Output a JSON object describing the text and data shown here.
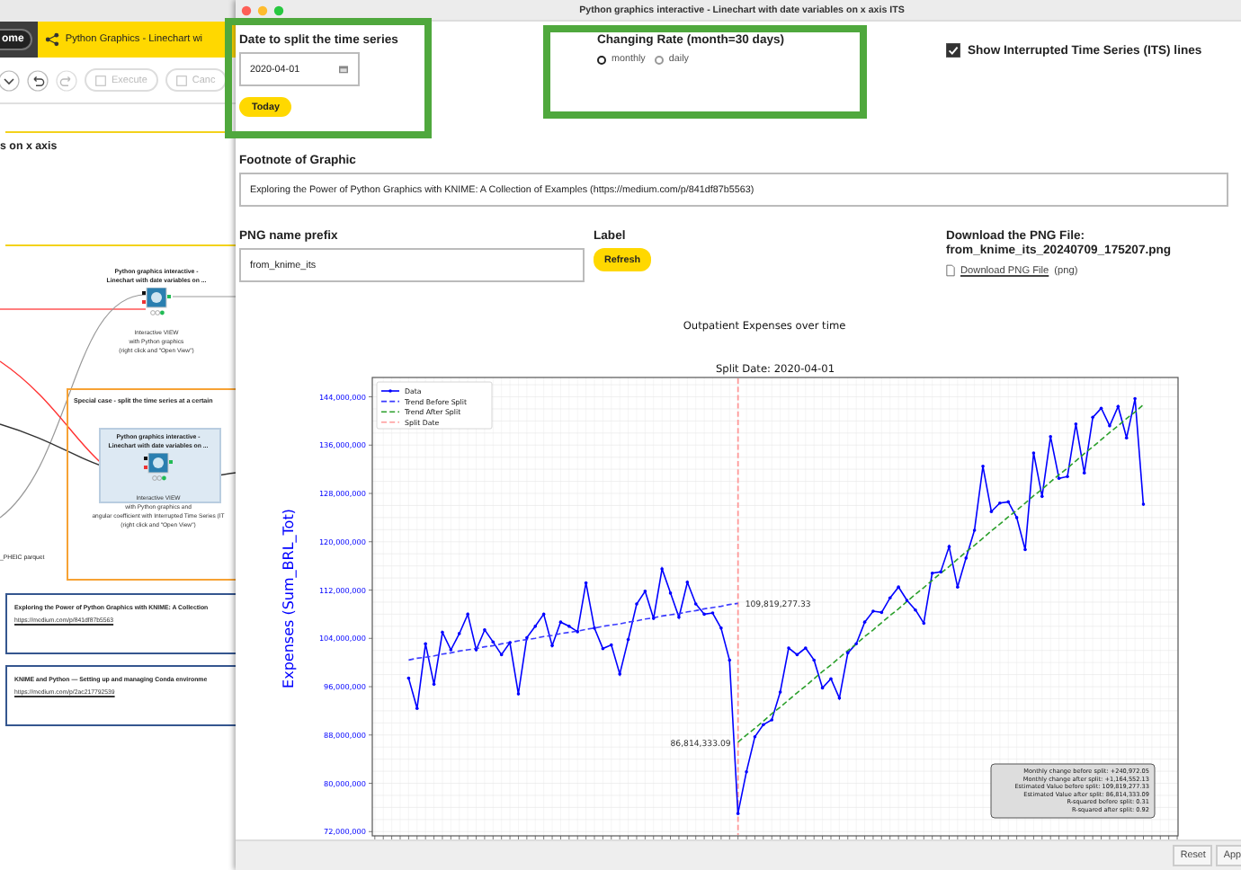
{
  "background_app": {
    "home_button": "ome",
    "tab": {
      "label": "Python Graphics - Linechart wi"
    },
    "toolbar": [
      {
        "label": "Execute",
        "disabled": true
      },
      {
        "label": "Canc",
        "disabled": true
      }
    ],
    "canvas": {
      "section_title": "s on x axis",
      "nodes": [
        {
          "title": [
            "Python graphics interactive -",
            "Linechart with date variables on ..."
          ],
          "caption": [
            "Interactive VIEW",
            "with Python graphics",
            "(right click and \"Open View\")"
          ],
          "selected": false
        },
        {
          "title": [
            "Python graphics interactive -",
            "Linechart with date variables on ..."
          ],
          "caption": [
            "Interactive VIEW",
            "with Python graphics and",
            "angular coefficient with Interrupted Time Series (IT",
            "(right click and \"Open View\")"
          ],
          "selected": true
        }
      ],
      "section": {
        "title": "Special case - split the time series at a certain"
      },
      "file_label": "_PHEIC parquet",
      "notes": [
        {
          "title": "Exploring the Power of Python Graphics with KNIME: A Collection",
          "link": "https://medium.com/p/841df87b5563"
        },
        {
          "title": "KNIME and Python — Setting up and managing Conda environme",
          "link": "https://medium.com/p/2ac217792539"
        }
      ]
    }
  },
  "dialog": {
    "title": "Python graphics interactive - Linechart with date variables on x axis ITS",
    "split_date": {
      "label": "Date to split the time series",
      "value": "2020-04-01",
      "button": "Today"
    },
    "changing_rate": {
      "label": "Changing Rate (month=30 days)",
      "options": [
        {
          "label": "monthly",
          "selected": true
        },
        {
          "label": "daily",
          "selected": false
        }
      ]
    },
    "its_lines": {
      "label": "Show Interrupted Time Series (ITS) lines",
      "checked": true
    },
    "footnote": {
      "label": "Footnote of Graphic",
      "value": "Exploring the Power of Python Graphics with KNIME: A Collection of Examples (https://medium.com/p/841df87b5563)"
    },
    "png_prefix": {
      "label": "PNG name prefix",
      "value": "from_knime_its"
    },
    "refresh": {
      "label": "Label",
      "button": "Refresh"
    },
    "download": {
      "title": "Download the PNG File:",
      "filename": "from_knime_its_20240709_175207.png",
      "link": "Download PNG File",
      "suffix": "(png)"
    },
    "chart": {
      "heading": "Outpatient Expenses over time",
      "chart_data": {
        "type": "line",
        "title": "Split Date: 2020-04-01",
        "ylabel": "Expenses (Sum_BRL_Tot)",
        "ylim": [
          71300000,
          147200000
        ],
        "grid": true,
        "legend": "upper left",
        "yticks": [
          {
            "value": 72000000,
            "label": "72,000,000"
          },
          {
            "value": 80000000,
            "label": "80,000,000"
          },
          {
            "value": 88000000,
            "label": "88,000,000"
          },
          {
            "value": 96000000,
            "label": "96,000,000"
          },
          {
            "value": 104000000,
            "label": "104,000,000"
          },
          {
            "value": 112000000,
            "label": "112,000,000"
          },
          {
            "value": 120000000,
            "label": "120,000,000"
          },
          {
            "value": 128000000,
            "label": "128,000,000"
          },
          {
            "value": 136000000,
            "label": "136,000,000"
          },
          {
            "value": 144000000,
            "label": "144,000,000"
          }
        ],
        "series": [
          {
            "name": "Data",
            "line_style": "solid",
            "color": "#0000ff",
            "values": [
              97400000,
              92400000,
              103100000,
              96400000,
              105000000,
              102100000,
              104800000,
              108000000,
              102100000,
              105400000,
              103400000,
              101300000,
              103300000,
              94800000,
              104100000,
              106000000,
              108000000,
              102800000,
              106700000,
              106000000,
              105100000,
              113200000,
              105700000,
              102300000,
              102900000,
              98100000,
              103800000,
              109700000,
              111800000,
              107300000,
              115500000,
              111500000,
              107500000,
              113300000,
              109700000,
              108000000,
              108200000,
              105700000,
              100400000,
              75000000,
              81900000,
              87700000,
              89700000,
              90500000,
              95100000,
              102400000,
              101300000,
              102400000,
              100400000,
              95800000,
              97300000,
              94100000,
              101600000,
              103100000,
              106700000,
              108500000,
              108300000,
              110700000,
              112500000,
              110300000,
              108700000,
              106500000,
              114800000,
              115000000,
              119200000,
              112500000,
              117300000,
              121900000,
              132500000,
              125000000,
              126400000,
              126600000,
              124000000,
              118700000,
              134700000,
              127500000,
              137400000,
              130500000,
              130800000,
              139500000,
              131400000,
              140600000,
              142100000,
              139200000,
              142400000,
              137200000,
              143700000,
              126200000
            ]
          },
          {
            "name": "Trend Before Split",
            "line_style": "dashed",
            "color": "#3a3aff",
            "values": [
              100400000,
              100700000,
              100900000,
              101100000,
              101400000,
              101600000,
              101900000,
              102100000,
              102300000,
              102600000,
              102800000,
              103100000,
              103300000,
              103600000,
              103800000,
              104000000,
              104300000,
              104500000,
              104800000,
              105000000,
              105200000,
              105500000,
              105700000,
              106000000,
              106200000,
              106400000,
              106700000,
              106900000,
              107200000,
              107400000,
              107700000,
              107900000,
              108100000,
              108400000,
              108600000,
              108900000,
              109100000,
              109300000,
              109600000,
              109800000,
              null,
              null,
              null,
              null,
              null,
              null,
              null,
              null,
              null,
              null,
              null,
              null,
              null,
              null,
              null,
              null,
              null,
              null,
              null,
              null,
              null,
              null,
              null,
              null,
              null,
              null,
              null,
              null,
              null,
              null,
              null,
              null,
              null,
              null,
              null,
              null,
              null,
              null,
              null,
              null,
              null,
              null,
              null,
              null,
              null,
              null,
              null,
              null
            ]
          },
          {
            "name": "Trend After Split",
            "line_style": "dashed",
            "color": "#2ca02c",
            "values": [
              null,
              null,
              null,
              null,
              null,
              null,
              null,
              null,
              null,
              null,
              null,
              null,
              null,
              null,
              null,
              null,
              null,
              null,
              null,
              null,
              null,
              null,
              null,
              null,
              null,
              null,
              null,
              null,
              null,
              null,
              null,
              null,
              null,
              null,
              null,
              null,
              null,
              null,
              null,
              86800000,
              88000000,
              89100000,
              90300000,
              91500000,
              92600000,
              93800000,
              95000000,
              96100000,
              97300000,
              98500000,
              99600000,
              100800000,
              102000000,
              103100000,
              104300000,
              105400000,
              106600000,
              107800000,
              108900000,
              110100000,
              111300000,
              112400000,
              113600000,
              114800000,
              115900000,
              117100000,
              118300000,
              119400000,
              120600000,
              121800000,
              122900000,
              124100000,
              125200000,
              126400000,
              127600000,
              128700000,
              129900000,
              131100000,
              132200000,
              133400000,
              134600000,
              135700000,
              136900000,
              138100000,
              139200000,
              140400000,
              141500000,
              142700000
            ]
          }
        ],
        "ref_lines": [
          {
            "axis": "x",
            "label": "Split Date",
            "color": "#ff9999",
            "line_style": "dashed"
          }
        ],
        "annotations": [
          "109,819,277.33",
          "86,814,333.09"
        ]
      },
      "stats": [
        "Monthly change before split: +240,972.05",
        "Monthly change after split: +1,164,552.13",
        "Estimated Value before split: 109,819,277.33",
        "Estimated Value after split: 86,814,333.09",
        "R-squared before split: 0.31",
        "R-squared after split: 0.92"
      ]
    },
    "buttons": [
      "Reset",
      "App"
    ]
  }
}
